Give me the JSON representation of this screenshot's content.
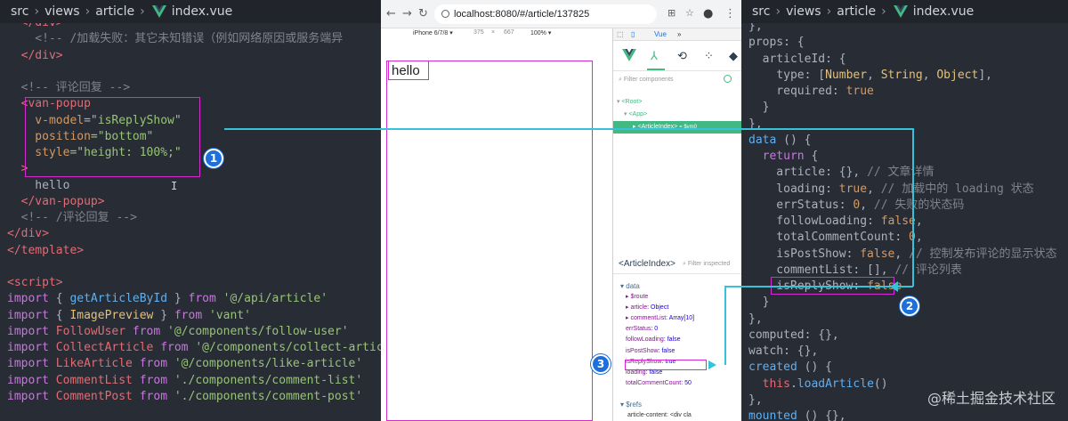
{
  "left_editor": {
    "breadcrumb": [
      "src",
      "views",
      "article",
      "index.vue"
    ],
    "lines": [
      [
        [
          "  </div>",
          "tag"
        ]
      ],
      [
        [
          "    <!-- /加载失败：其它未知错误（例如网络原因或服务端异",
          "com"
        ]
      ],
      [
        [
          "  </div>",
          "tag"
        ]
      ],
      [
        [
          "",
          "punc"
        ]
      ],
      [
        [
          "  <!-- 评论回复 -->",
          "com"
        ]
      ],
      [
        [
          "  <van-popup",
          "tag"
        ]
      ],
      [
        [
          "    v-model",
          "attr"
        ],
        [
          "=\"",
          "punc"
        ],
        [
          "isReplyShow",
          "str"
        ],
        [
          "\"",
          "punc"
        ]
      ],
      [
        [
          "    position",
          "attr"
        ],
        [
          "=\"bottom\"",
          "str"
        ]
      ],
      [
        [
          "    style",
          "attr"
        ],
        [
          "=\"height: 100%;\"",
          "str"
        ]
      ],
      [
        [
          "  >",
          "tag"
        ]
      ],
      [
        [
          "    hello",
          "punc"
        ]
      ],
      [
        [
          "  </van-popup>",
          "tag"
        ]
      ],
      [
        [
          "  <!-- /评论回复 -->",
          "com"
        ]
      ],
      [
        [
          "</div>",
          "tag"
        ]
      ],
      [
        [
          "</template>",
          "tag"
        ]
      ],
      [
        [
          "",
          "punc"
        ]
      ],
      [
        [
          "<script>",
          "tag"
        ]
      ],
      [
        [
          "import",
          "kw"
        ],
        [
          " { ",
          "punc"
        ],
        [
          "getArticleById",
          "fn"
        ],
        [
          " } ",
          "punc"
        ],
        [
          "from",
          "kw"
        ],
        [
          " '@/api/article'",
          "str"
        ]
      ],
      [
        [
          "import",
          "kw"
        ],
        [
          " { ",
          "punc"
        ],
        [
          "ImagePreview",
          "typ"
        ],
        [
          " } ",
          "punc"
        ],
        [
          "from",
          "kw"
        ],
        [
          " 'vant'",
          "str"
        ]
      ],
      [
        [
          "import",
          "kw"
        ],
        [
          " FollowUser ",
          "tag"
        ],
        [
          "from",
          "kw"
        ],
        [
          " '@/components/follow-user'",
          "str"
        ]
      ],
      [
        [
          "import",
          "kw"
        ],
        [
          " CollectArticle ",
          "tag"
        ],
        [
          "from",
          "kw"
        ],
        [
          " '@/components/collect-article'",
          "str"
        ]
      ],
      [
        [
          "import",
          "kw"
        ],
        [
          " LikeArticle ",
          "tag"
        ],
        [
          "from",
          "kw"
        ],
        [
          " '@/components/like-article'",
          "str"
        ]
      ],
      [
        [
          "import",
          "kw"
        ],
        [
          " CommentList ",
          "tag"
        ],
        [
          "from",
          "kw"
        ],
        [
          " './components/comment-list'",
          "str"
        ]
      ],
      [
        [
          "import",
          "kw"
        ],
        [
          " CommentPost ",
          "tag"
        ],
        [
          "from",
          "kw"
        ],
        [
          " './components/comment-post'",
          "str"
        ]
      ]
    ]
  },
  "right_editor": {
    "breadcrumb": [
      "src",
      "views",
      "article",
      "index.vue"
    ],
    "lines": [
      [
        [
          "},",
          "punc"
        ]
      ],
      [
        [
          "props",
          "prop"
        ],
        [
          ": {",
          "punc"
        ]
      ],
      [
        [
          "  articleId",
          "prop"
        ],
        [
          ": {",
          "punc"
        ]
      ],
      [
        [
          "    type",
          "prop"
        ],
        [
          ": [",
          "punc"
        ],
        [
          "Number",
          "typ"
        ],
        [
          ", ",
          "punc"
        ],
        [
          "String",
          "typ"
        ],
        [
          ", ",
          "punc"
        ],
        [
          "Object",
          "typ"
        ],
        [
          "],",
          "punc"
        ]
      ],
      [
        [
          "    required",
          "prop"
        ],
        [
          ": ",
          "punc"
        ],
        [
          "true",
          "bool"
        ]
      ],
      [
        [
          "  }",
          "punc"
        ]
      ],
      [
        [
          "},",
          "punc"
        ]
      ],
      [
        [
          "data",
          "fn"
        ],
        [
          " () {",
          "punc"
        ]
      ],
      [
        [
          "  return",
          "kw"
        ],
        [
          " {",
          "punc"
        ]
      ],
      [
        [
          "    article",
          "prop"
        ],
        [
          ": {}, ",
          "punc"
        ],
        [
          "// 文章详情",
          "com"
        ]
      ],
      [
        [
          "    loading",
          "prop"
        ],
        [
          ": ",
          "punc"
        ],
        [
          "true",
          "bool"
        ],
        [
          ", ",
          "punc"
        ],
        [
          "// 加载中的 loading 状态",
          "com"
        ]
      ],
      [
        [
          "    errStatus",
          "prop"
        ],
        [
          ": ",
          "punc"
        ],
        [
          "0",
          "num"
        ],
        [
          ", ",
          "punc"
        ],
        [
          "// 失败的状态码",
          "com"
        ]
      ],
      [
        [
          "    followLoading",
          "prop"
        ],
        [
          ": ",
          "punc"
        ],
        [
          "false",
          "bool"
        ],
        [
          ",",
          "punc"
        ]
      ],
      [
        [
          "    totalCommentCount",
          "prop"
        ],
        [
          ": ",
          "punc"
        ],
        [
          "0",
          "num"
        ],
        [
          ",",
          "punc"
        ]
      ],
      [
        [
          "    isPostShow",
          "prop"
        ],
        [
          ": ",
          "punc"
        ],
        [
          "false",
          "bool"
        ],
        [
          ", ",
          "punc"
        ],
        [
          "// 控制发布评论的显示状态",
          "com"
        ]
      ],
      [
        [
          "    commentList",
          "prop"
        ],
        [
          ": [], ",
          "punc"
        ],
        [
          "// 评论列表",
          "com"
        ]
      ],
      [
        [
          "    isReplyShow",
          "prop"
        ],
        [
          ": ",
          "punc"
        ],
        [
          "false",
          "bool"
        ]
      ],
      [
        [
          "  }",
          "punc"
        ]
      ],
      [
        [
          "},",
          "punc"
        ]
      ],
      [
        [
          "computed",
          "prop"
        ],
        [
          ": {},",
          "punc"
        ]
      ],
      [
        [
          "watch",
          "prop"
        ],
        [
          ": {},",
          "punc"
        ]
      ],
      [
        [
          "created",
          "fn"
        ],
        [
          " () {",
          "punc"
        ]
      ],
      [
        [
          "  this",
          "tag"
        ],
        [
          ".",
          "punc"
        ],
        [
          "loadArticle",
          "fn"
        ],
        [
          "()",
          "punc"
        ]
      ],
      [
        [
          "},",
          "punc"
        ]
      ],
      [
        [
          "mounted",
          "fn"
        ],
        [
          " () {},",
          "punc"
        ]
      ]
    ]
  },
  "browser": {
    "url": "localhost:8080/#/article/137825",
    "device": "iPhone 6/7/8 ▾",
    "width": "375",
    "height": "667",
    "zoom": "100% ▾",
    "page_text": "hello"
  },
  "devtools": {
    "panel_tab": "Vue",
    "more_tabs": "»",
    "filter_placeholder": "Filter components",
    "tree": {
      "root": "<Root>",
      "app": "<App>",
      "selected": "<ArticleIndex>",
      "selected_suffix": "= $vm0"
    },
    "inspector": {
      "component": "<ArticleIndex>",
      "filter_placeholder": "Filter inspected",
      "section_data": "data",
      "rows": [
        [
          "▸ $route",
          ""
        ],
        [
          "▸ article",
          ": Object"
        ],
        [
          "▸ commentList",
          ": Array[10]"
        ],
        [
          "  errStatus",
          ": 0"
        ],
        [
          "  followLoading",
          ": false"
        ],
        [
          "  isPostShow",
          ": false"
        ],
        [
          "  isReplyShow",
          ": true"
        ],
        [
          "  loading",
          ": false"
        ],
        [
          "  totalCommentCount",
          ": 50"
        ]
      ],
      "section_refs": "$refs",
      "refs_row": "article-content: <div cla"
    }
  },
  "badges": [
    "1",
    "2",
    "3"
  ],
  "watermark": "@稀土掘金技术社区",
  "colors": {
    "editor_bg": "#282c34",
    "highlight": "#d42ad0",
    "badge": "#1e6fd9",
    "connector": "#36c2d8",
    "vue_green": "#42b883"
  }
}
